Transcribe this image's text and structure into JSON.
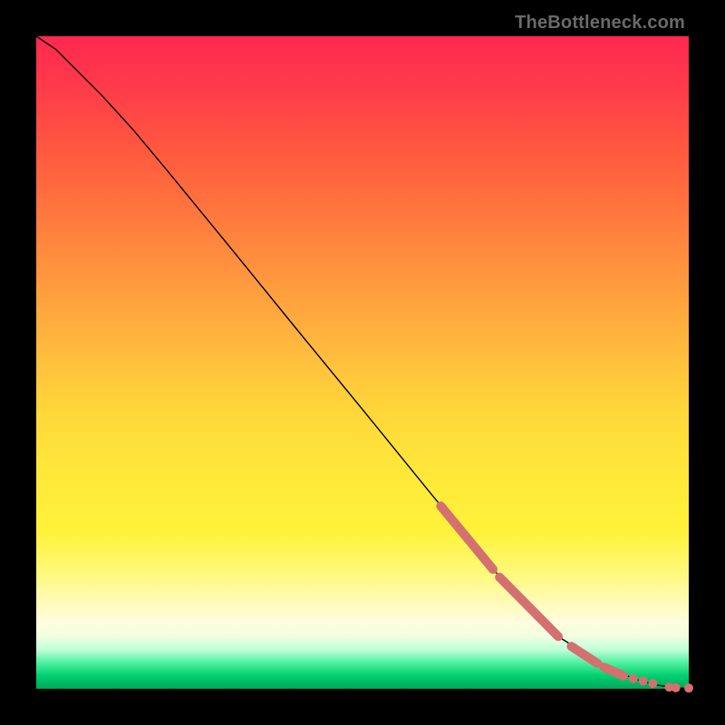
{
  "watermark": "TheBottleneck.com",
  "chart_data": {
    "type": "line",
    "title": "",
    "xlabel": "",
    "ylabel": "",
    "xlim": [
      0,
      100
    ],
    "ylim": [
      0,
      100
    ],
    "grid": false,
    "legend": false,
    "curve": {
      "x": [
        0,
        3,
        6,
        10,
        15,
        20,
        30,
        40,
        50,
        60,
        70,
        80,
        88,
        92,
        95,
        97,
        98.5,
        100
      ],
      "y": [
        100,
        98,
        95,
        91,
        85.5,
        79.5,
        67.3,
        55.0,
        42.8,
        30.5,
        18.3,
        8.0,
        3.0,
        1.4,
        0.6,
        0.25,
        0.1,
        0.1
      ]
    },
    "highlight_segments": [
      {
        "x0": 62,
        "y0": 28.0,
        "x1": 70,
        "y1": 18.3
      },
      {
        "x0": 71,
        "y0": 17.1,
        "x1": 80,
        "y1": 8.0
      },
      {
        "x0": 82,
        "y0": 6.5,
        "x1": 86,
        "y1": 3.9
      },
      {
        "x0": 87,
        "y0": 3.3,
        "x1": 90,
        "y1": 2.0
      }
    ],
    "highlight_points": [
      {
        "x": 91.5,
        "y": 1.55
      },
      {
        "x": 93.0,
        "y": 1.2
      },
      {
        "x": 94.5,
        "y": 0.8
      },
      {
        "x": 97.0,
        "y": 0.25
      },
      {
        "x": 98.0,
        "y": 0.15
      },
      {
        "x": 100.0,
        "y": 0.1
      }
    ]
  }
}
